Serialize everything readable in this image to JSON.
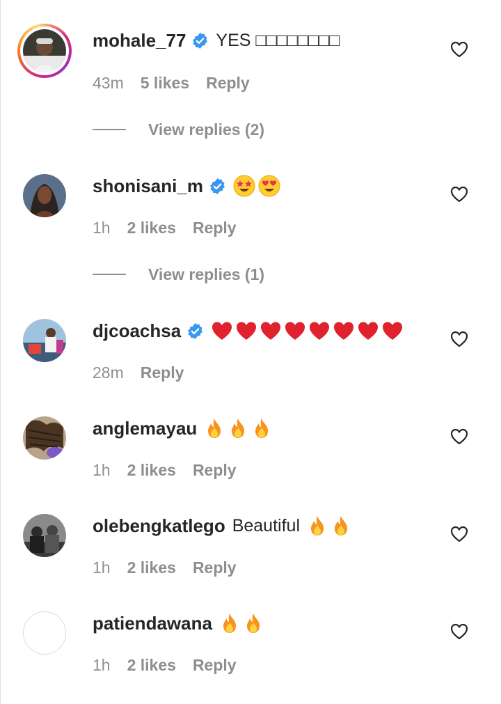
{
  "comments": [
    {
      "username": "mohale_77",
      "verified": true,
      "text": "YES □□□□□□□□",
      "time": "43m",
      "likes": "5 likes",
      "reply": "Reply",
      "view_replies": "View replies (2)"
    },
    {
      "username": "shonisani_m",
      "verified": true,
      "emojis": [
        "star-struck",
        "heart-eyes"
      ],
      "time": "1h",
      "likes": "2 likes",
      "reply": "Reply",
      "view_replies": "View replies (1)"
    },
    {
      "username": "djcoachsa",
      "verified": true,
      "emojis": [
        "red-heart",
        "red-heart",
        "red-heart",
        "red-heart",
        "red-heart",
        "red-heart",
        "red-heart",
        "red-heart"
      ],
      "time": "28m",
      "reply": "Reply"
    },
    {
      "username": "anglemayau",
      "verified": false,
      "emojis": [
        "fire",
        "fire",
        "fire"
      ],
      "time": "1h",
      "likes": "2 likes",
      "reply": "Reply"
    },
    {
      "username": "olebengkatlego",
      "verified": false,
      "text": "Beautiful",
      "emojis": [
        "fire",
        "fire"
      ],
      "time": "1h",
      "likes": "2 likes",
      "reply": "Reply"
    },
    {
      "username": "patiendawana",
      "verified": false,
      "emojis": [
        "fire",
        "fire"
      ],
      "time": "1h",
      "likes": "2 likes",
      "reply": "Reply"
    }
  ],
  "colors": {
    "verified_blue": "#3897f0",
    "meta_gray": "#8e8e8e",
    "text": "#262626",
    "heart_red": "#e0212e",
    "fire_orange": "#f7931e"
  }
}
